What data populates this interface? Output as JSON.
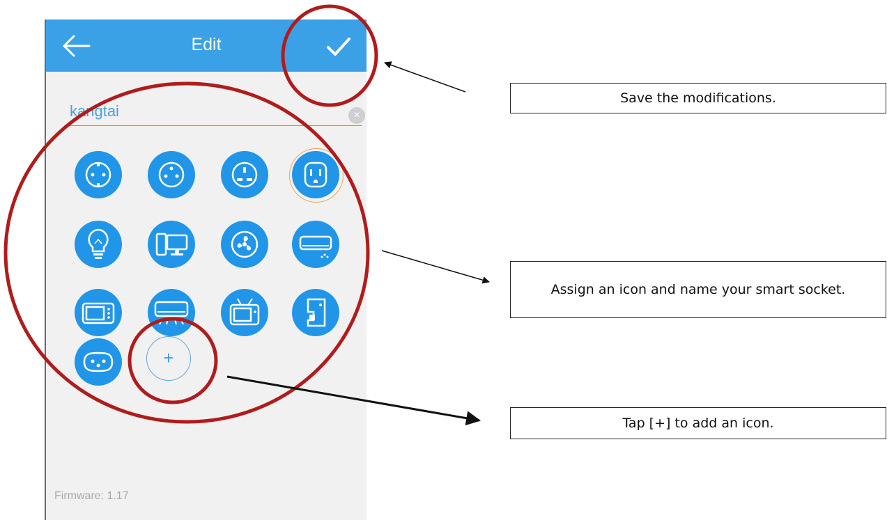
{
  "header": {
    "title": "Edit"
  },
  "name_field": {
    "value": "kangtai"
  },
  "icons": [
    "socket-schuko-icon",
    "socket-type-f-icon",
    "socket-uk-icon",
    "socket-us-icon",
    "bulb-icon",
    "computer-icon",
    "fan-icon",
    "air-conditioner-icon",
    "microwave-icon",
    "ac-unit-icon",
    "tv-icon",
    "coffee-machine-icon",
    "socket-swiss-icon"
  ],
  "selected_icon": "socket-us-icon",
  "add_button": {
    "label": "+"
  },
  "footer": {
    "firmware": "Firmware: 1.17"
  },
  "callouts": {
    "save": "Save the modifications.",
    "assign": "Assign an icon and name your smart socket.",
    "add": "Tap [+] to add an icon."
  },
  "colors": {
    "app_bar": "#3aa1e6",
    "icon_fill": "#2196e8",
    "annotation_circle": "#b01c1c",
    "selected_ring": "#f0a050"
  }
}
